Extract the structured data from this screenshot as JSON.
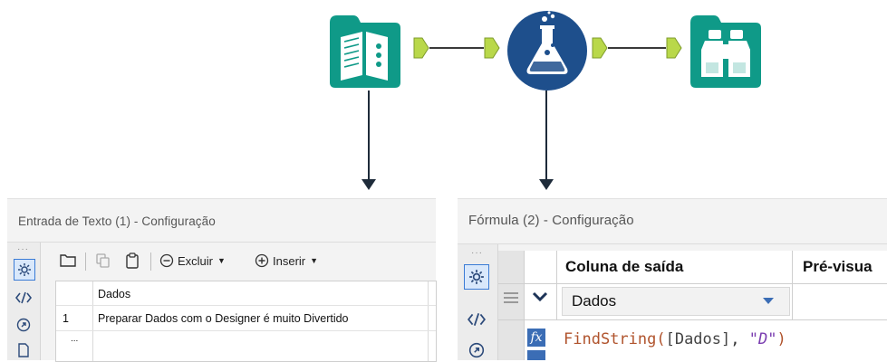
{
  "workflow": {
    "tools": [
      {
        "name": "Entrada de Texto",
        "icon": "book-icon",
        "color": "#0f9a88"
      },
      {
        "name": "Fórmula",
        "icon": "flask-icon",
        "color": "#1e4f8c"
      },
      {
        "name": "Navegar",
        "icon": "binoculars-icon",
        "color": "#0f9a88"
      }
    ],
    "anchor_color": "#b9d84a"
  },
  "text_input_panel": {
    "title": "Entrada de Texto (1) - Configuração",
    "toolbar": {
      "delete_label": "Excluir",
      "insert_label": "Inserir"
    },
    "table": {
      "header": "Dados",
      "rows": [
        {
          "num": "1",
          "value": "Preparar Dados com o Designer é muito Divertido"
        }
      ],
      "new_row_marker": "..."
    }
  },
  "formula_panel": {
    "title": "Fórmula (2) - Configuração",
    "columns": {
      "output": "Coluna de saída",
      "preview": "Pré-visua"
    },
    "row": {
      "output_field": "Dados",
      "expression_fn": "FindString(",
      "expression_field": "[Dados]",
      "expression_sep": ", ",
      "expression_str": "\"D\"",
      "expression_close": ")"
    }
  }
}
